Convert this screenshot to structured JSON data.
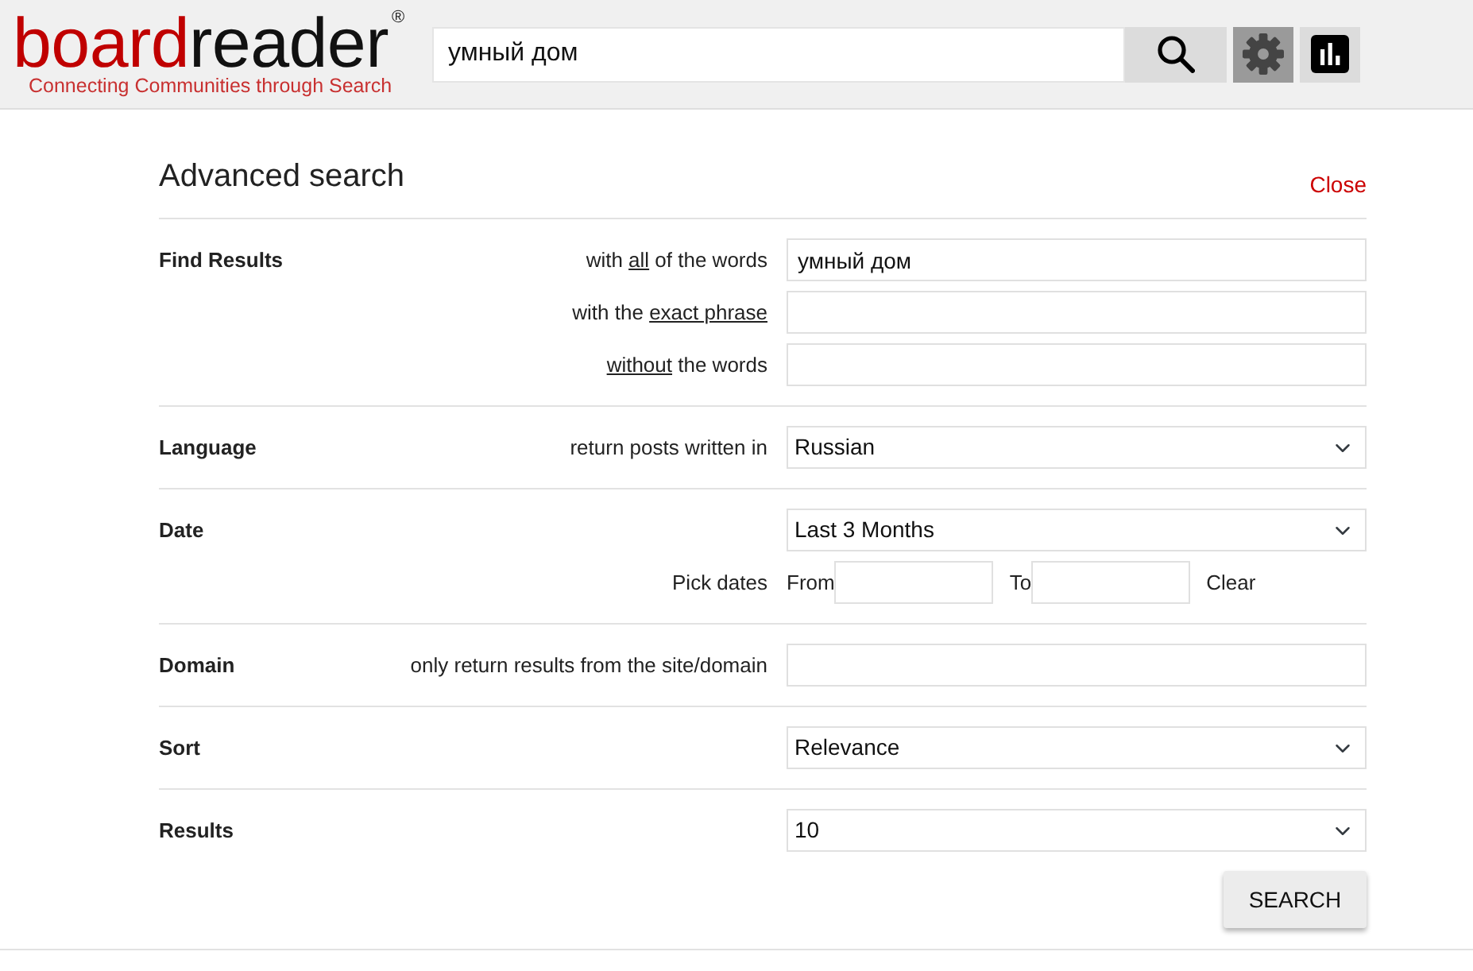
{
  "header": {
    "logo": {
      "parts": [
        {
          "text": "board",
          "color": "#c00000"
        },
        {
          "text": "reader",
          "color": "#111111"
        }
      ],
      "mark": "®",
      "tagline": "Connecting Communities through Search"
    },
    "search": {
      "value": "умный дом"
    },
    "buttons": [
      {
        "kind": "search",
        "selected": false
      },
      {
        "kind": "settings",
        "selected": true
      },
      {
        "kind": "stats",
        "selected": false
      }
    ]
  },
  "panel": {
    "title": "Advanced search",
    "close": "Close",
    "sections": [
      {
        "label": "Find Results",
        "rows": [
          {
            "kind": "text",
            "description": [
              {
                "text": "with ",
                "underline": false
              },
              {
                "text": "all",
                "underline": true
              },
              {
                "text": " of the words",
                "underline": false
              }
            ],
            "value": "умный дом"
          },
          {
            "kind": "text",
            "description": [
              {
                "text": "with the ",
                "underline": false
              },
              {
                "text": "exact phrase",
                "underline": true
              }
            ]
          },
          {
            "kind": "text",
            "description": [
              {
                "text": "without",
                "underline": true
              },
              {
                "text": " the words",
                "underline": false
              }
            ]
          }
        ]
      },
      {
        "label": "Language",
        "rows": [
          {
            "kind": "select",
            "description": [
              {
                "text": "return posts written in",
                "underline": false
              }
            ],
            "value": "Russian"
          }
        ]
      },
      {
        "label": "Date",
        "rows": [
          {
            "kind": "select",
            "value": "Last 3 Months"
          },
          {
            "kind": "range",
            "description": [
              {
                "text": "Pick dates",
                "underline": false
              }
            ],
            "from_label": "From",
            "to_label": "To",
            "clear": "Clear"
          }
        ]
      },
      {
        "label": "Domain",
        "rows": [
          {
            "kind": "text",
            "description": [
              {
                "text": "only return results from the site/domain",
                "underline": false
              }
            ]
          }
        ]
      },
      {
        "label": "Sort",
        "rows": [
          {
            "kind": "select",
            "value": "Relevance"
          }
        ]
      },
      {
        "label": "Results",
        "rows": [
          {
            "kind": "select",
            "value": "10"
          }
        ]
      }
    ],
    "submit": "SEARCH"
  }
}
